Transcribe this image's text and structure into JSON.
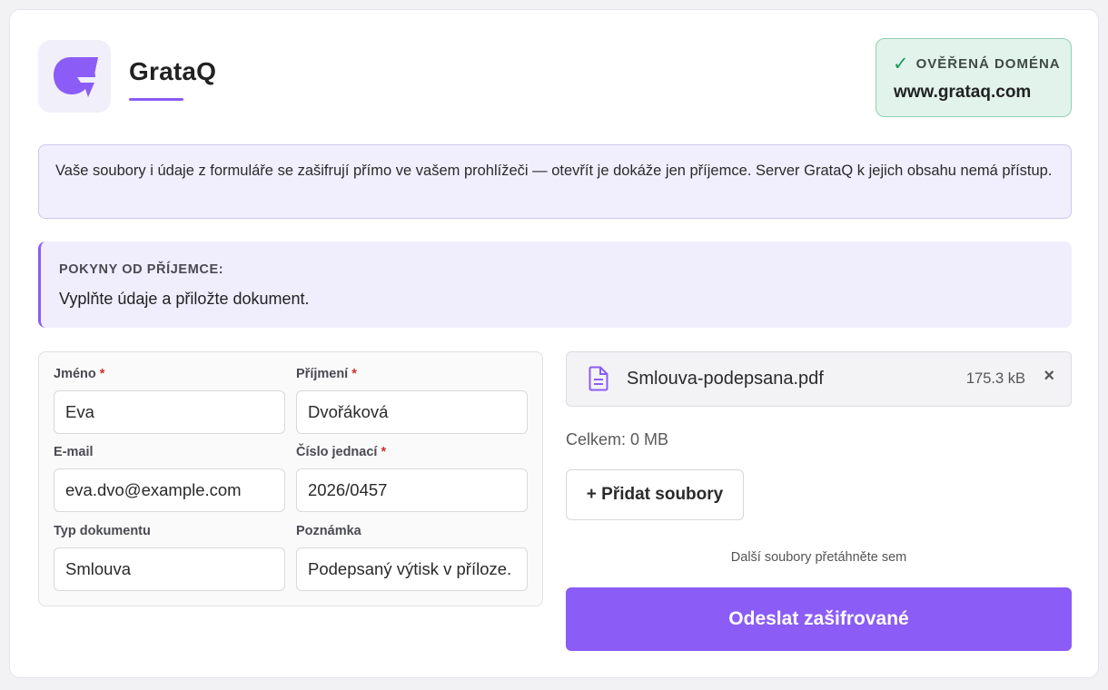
{
  "brand": {
    "name": "GrataQ",
    "logo_icon": "grataq-logo-icon",
    "accent_color": "#8b5cf6"
  },
  "verified": {
    "icon": "check-icon",
    "label": "OVĚŘENÁ DOMÉNA",
    "domain": "www.grataq.com",
    "color": "#1f9a5b"
  },
  "notice": {
    "text": "Vaše soubory i údaje z formuláře se zašifrují přímo ve vašem prohlížeči — otevřít je dokáže jen příjemce. Server GrataQ k jejich obsahu nemá přístup."
  },
  "instructions": {
    "title": "POKYNY OD PŘÍJEMCE:",
    "text": "Vyplňte údaje a přiložte dokument."
  },
  "form": {
    "first_name": {
      "label": "Jméno",
      "required_mark": "*",
      "value": "Eva"
    },
    "last_name": {
      "label": "Příjmení",
      "required_mark": "*",
      "value": "Dvořáková"
    },
    "email": {
      "label": "E-mail",
      "value": "eva.dvo@example.com"
    },
    "reference": {
      "label": "Číslo jednací",
      "required_mark": "*",
      "value": "2026/0457"
    },
    "doc_type": {
      "label": "Typ dokumentu",
      "value": "Smlouva"
    },
    "note": {
      "label": "Poznámka",
      "value": "Podepsaný výtisk v příloze."
    }
  },
  "files": {
    "items": [
      {
        "icon": "document-icon",
        "name": "Smlouva-podepsana.pdf",
        "size": "175.3 kB",
        "remove": "×"
      }
    ],
    "total": "Celkem: 0 MB",
    "add_label": "+ Přidat soubory",
    "drop_hint": "Další soubory přetáhněte sem"
  },
  "submit": {
    "label": "Odeslat zašifrované"
  }
}
